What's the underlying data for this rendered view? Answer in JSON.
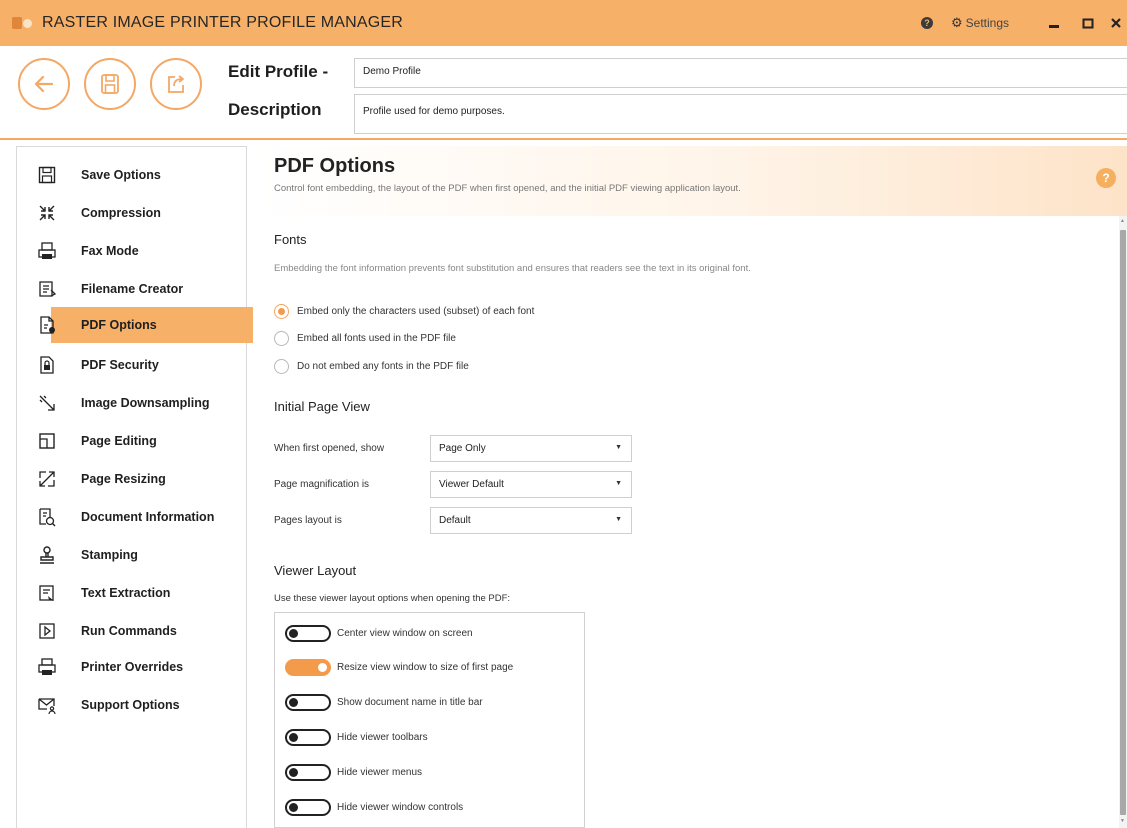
{
  "window": {
    "title": "RASTER IMAGE PRINTER PROFILE MANAGER",
    "settings_label": "Settings"
  },
  "header": {
    "edit_profile_label": "Edit Profile -",
    "description_label": "Description",
    "profile_name": "Demo Profile",
    "profile_description": "Profile used for demo purposes."
  },
  "sidebar": {
    "items": [
      {
        "label": "Save Options",
        "icon": "save-icon"
      },
      {
        "label": "Compression",
        "icon": "compress-icon"
      },
      {
        "label": "Fax Mode",
        "icon": "fax-icon"
      },
      {
        "label": "Filename Creator",
        "icon": "filename-icon"
      },
      {
        "label": "PDF Options",
        "icon": "pdf-options-icon",
        "active": true
      },
      {
        "label": "PDF Security",
        "icon": "lock-file-icon"
      },
      {
        "label": "Image Downsampling",
        "icon": "downsample-icon"
      },
      {
        "label": "Page Editing",
        "icon": "page-edit-icon"
      },
      {
        "label": "Page Resizing",
        "icon": "resize-icon"
      },
      {
        "label": "Document Information",
        "icon": "doc-info-icon"
      },
      {
        "label": "Stamping",
        "icon": "stamp-icon"
      },
      {
        "label": "Text Extraction",
        "icon": "text-extract-icon"
      },
      {
        "label": "Run Commands",
        "icon": "run-icon"
      },
      {
        "label": "Printer Overrides",
        "icon": "printer-icon"
      },
      {
        "label": "Support Options",
        "icon": "support-mail-icon"
      }
    ]
  },
  "page": {
    "title": "PDF Options",
    "subtitle": "Control font embedding, the layout of the PDF when first opened, and the initial PDF viewing application layout.",
    "help": "?"
  },
  "fonts": {
    "title": "Fonts",
    "description": "Embedding the font information prevents font substitution and ensures that readers see the text in its original font.",
    "options": [
      {
        "label": "Embed only the characters used (subset) of each font",
        "selected": true
      },
      {
        "label": "Embed all fonts used in the PDF file",
        "selected": false
      },
      {
        "label": "Do not embed any fonts in the PDF file",
        "selected": false
      }
    ]
  },
  "initial_view": {
    "title": "Initial Page View",
    "rows": [
      {
        "label": "When first opened, show",
        "value": "Page Only"
      },
      {
        "label": "Page magnification is",
        "value": "Viewer Default"
      },
      {
        "label": "Pages layout is",
        "value": "Default"
      }
    ]
  },
  "viewer_layout": {
    "title": "Viewer Layout",
    "description": "Use these viewer layout options when opening the PDF:",
    "toggles": [
      {
        "label": "Center view window on screen",
        "on": false
      },
      {
        "label": "Resize view window to size of first page",
        "on": true
      },
      {
        "label": "Show document name in title bar",
        "on": false
      },
      {
        "label": "Hide viewer toolbars",
        "on": false
      },
      {
        "label": "Hide viewer menus",
        "on": false
      },
      {
        "label": "Hide viewer window controls",
        "on": false
      }
    ]
  },
  "colors": {
    "accent": "#f7b067",
    "toggle_on": "#f49b4b"
  }
}
